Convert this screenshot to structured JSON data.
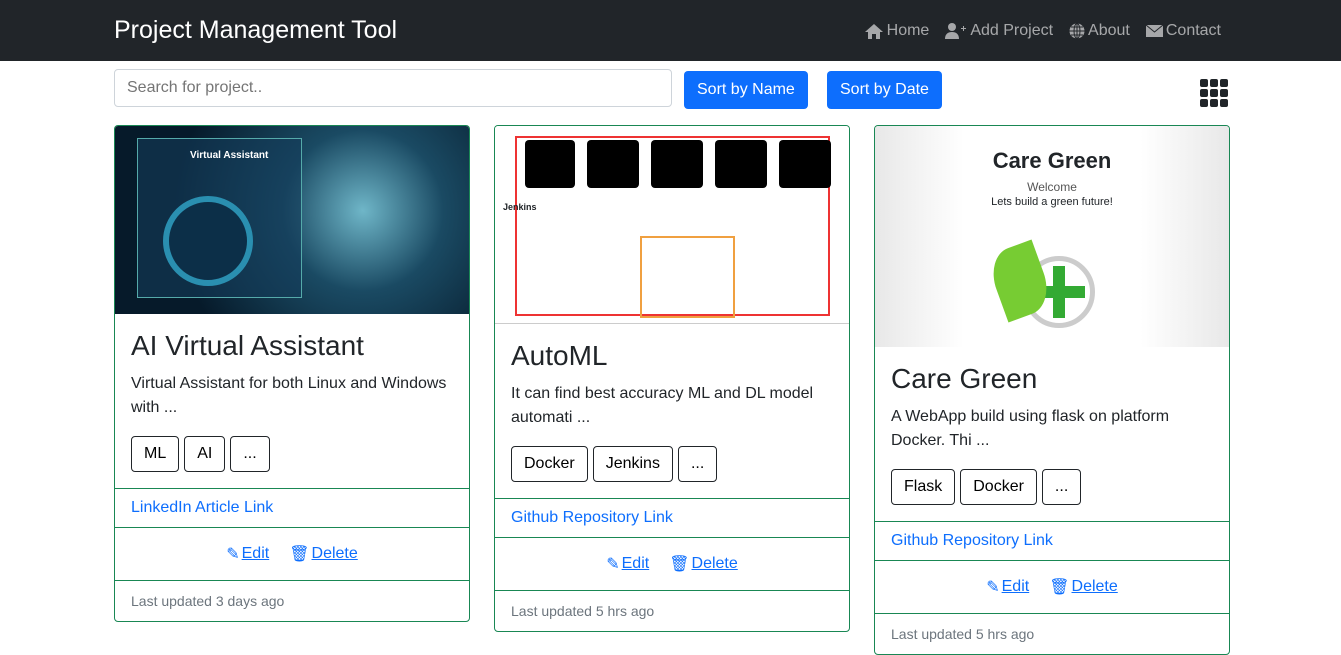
{
  "nav": {
    "brand": "Project Management Tool",
    "links": [
      {
        "label": "Home",
        "icon": "home-icon"
      },
      {
        "label": "Add Project",
        "icon": "user-plus-icon"
      },
      {
        "label": "About",
        "icon": "globe-icon"
      },
      {
        "label": "Contact",
        "icon": "envelope-icon"
      }
    ]
  },
  "toolbar": {
    "search_placeholder": "Search for project..",
    "sort_name": "Sort by Name",
    "sort_date": "Sort by Date",
    "view_icon": "grid-icon"
  },
  "colors": {
    "accent": "#0d6efd",
    "card_border": "#198754",
    "edit": "#198754",
    "delete": "#dc3545",
    "navbar": "#212529"
  },
  "cards": [
    {
      "title": "AI Virtual Assistant",
      "desc": "Virtual Assistant for both Linux and Windows with ...",
      "tags": [
        "ML",
        "AI",
        "..."
      ],
      "link": "LinkedIn Article Link",
      "edit": "Edit",
      "delete": "Delete",
      "updated": "Last updated 3 days ago",
      "image_text": "Virtual Assistant"
    },
    {
      "title": "AutoML",
      "desc": "It can find best accuracy ML and DL model automati ...",
      "tags": [
        "Docker",
        "Jenkins",
        "..."
      ],
      "link": "Github Repository Link",
      "edit": "Edit",
      "delete": "Delete",
      "updated": "Last updated 5 hrs ago",
      "image_text": "Jenkins"
    },
    {
      "title": "Care Green",
      "desc": "A WebApp build using flask on platform Docker. Thi ...",
      "tags": [
        "Flask",
        "Docker",
        "..."
      ],
      "link": "Github Repository Link",
      "edit": "Edit",
      "delete": "Delete",
      "updated": "Last updated 5 hrs ago",
      "image_text": "Care Green",
      "image_sub": "Welcome",
      "image_tag": "Lets build a green future!"
    }
  ]
}
